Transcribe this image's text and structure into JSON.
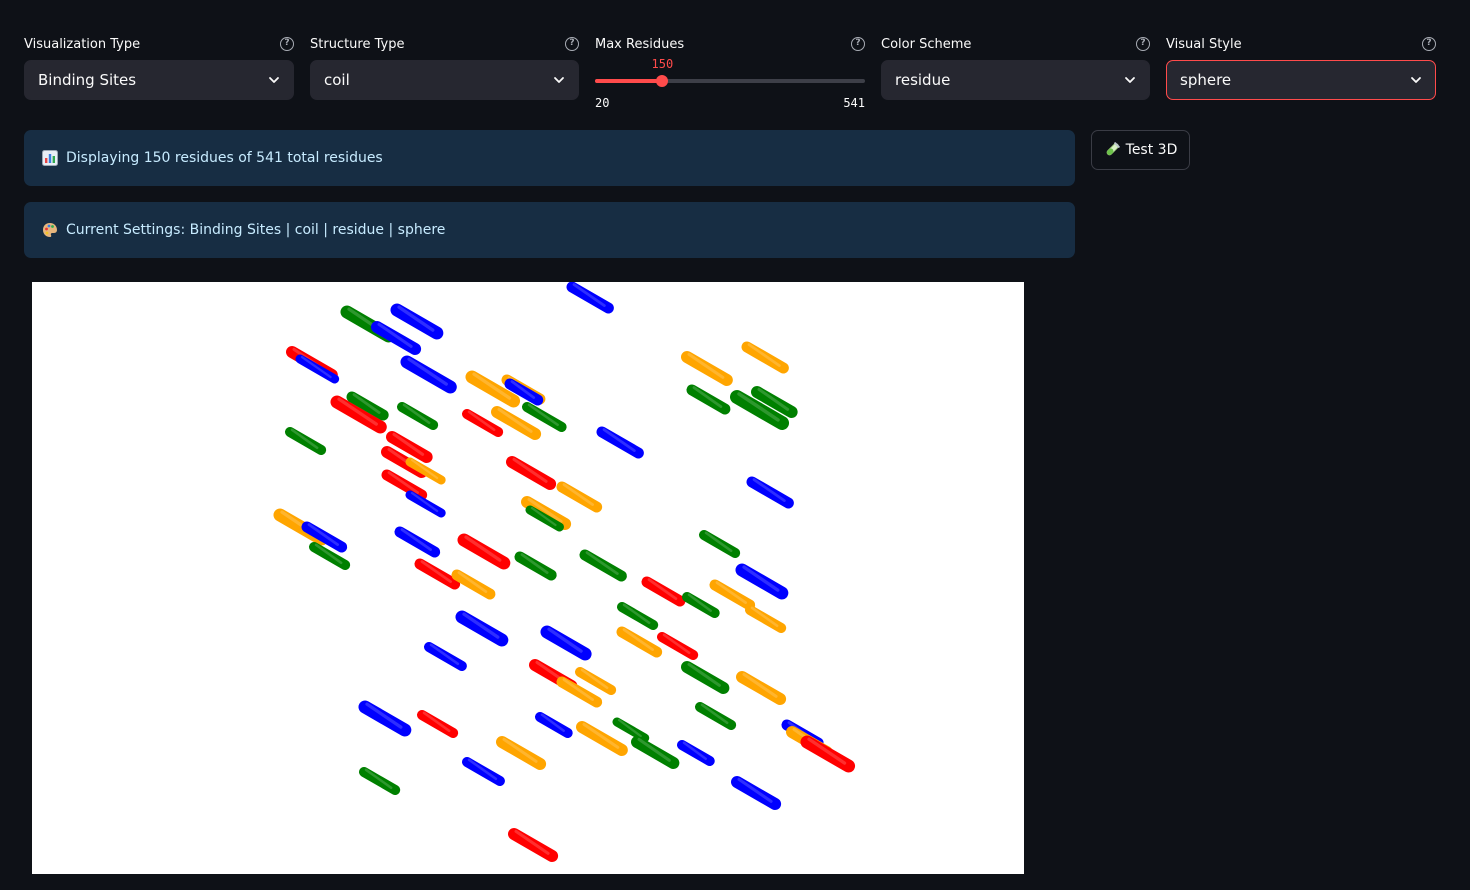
{
  "controls": {
    "visualization_type": {
      "label": "Visualization Type",
      "value": "Binding Sites"
    },
    "structure_type": {
      "label": "Structure Type",
      "value": "coil"
    },
    "max_residues": {
      "label": "Max Residues",
      "value": "150",
      "min": "20",
      "max": "541",
      "numeric_value": 150,
      "numeric_min": 20,
      "numeric_max": 541
    },
    "color_scheme": {
      "label": "Color Scheme",
      "value": "residue"
    },
    "visual_style": {
      "label": "Visual Style",
      "value": "sphere"
    }
  },
  "info": {
    "displaying_icon": "bar-chart-icon",
    "displaying_text": "Displaying 150 residues of 541 total residues",
    "settings_icon": "palette-icon",
    "settings_text": "Current Settings: Binding Sites | coil | residue | sphere"
  },
  "test_button": {
    "icon": "test-tube-icon",
    "label": "Test 3D"
  },
  "colors": {
    "accent": "#ff4b4b",
    "background": "#0e1117",
    "widget": "#262730",
    "info_bg": "#172d43",
    "info_text": "#c7ebff",
    "residue_palette": [
      "#ff0000",
      "#0000ff",
      "#008000",
      "#ffa500"
    ]
  }
}
